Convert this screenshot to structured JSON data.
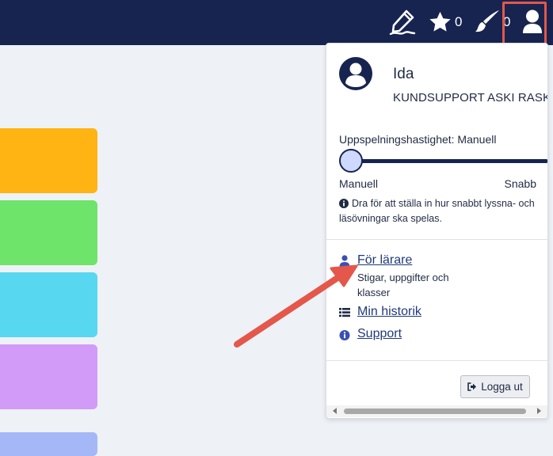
{
  "topbar": {
    "icons": [
      "edit-pen-icon",
      "star-icon",
      "brush-icon",
      "user-icon"
    ],
    "star_count": "0",
    "brush_count": "0"
  },
  "tiles": {
    "colors": [
      "#ffb414",
      "#6fe46a",
      "#57d8f0",
      "#d29bf8",
      "#a6b7f7"
    ]
  },
  "panel": {
    "user": {
      "name": "Ida",
      "organization": "KUNDSUPPORT ASKI RASK"
    },
    "playback": {
      "label": "Uppspelningshastighet: Manuell",
      "min_label": "Manuell",
      "max_label": "Snabb",
      "value": 0,
      "hint": "Dra för att ställa in hur snabbt lyssna- och läsövningar ska spelas."
    },
    "menu": {
      "for_teachers": {
        "label": "För lärare",
        "description": "Stigar, uppgifter och klasser"
      },
      "history": {
        "label": "Min historik"
      },
      "support": {
        "label": "Support"
      }
    },
    "logout_label": "Logga ut"
  },
  "colors": {
    "topbar": "#17244f",
    "highlight": "#e5574a",
    "link": "#1f3a7a"
  }
}
